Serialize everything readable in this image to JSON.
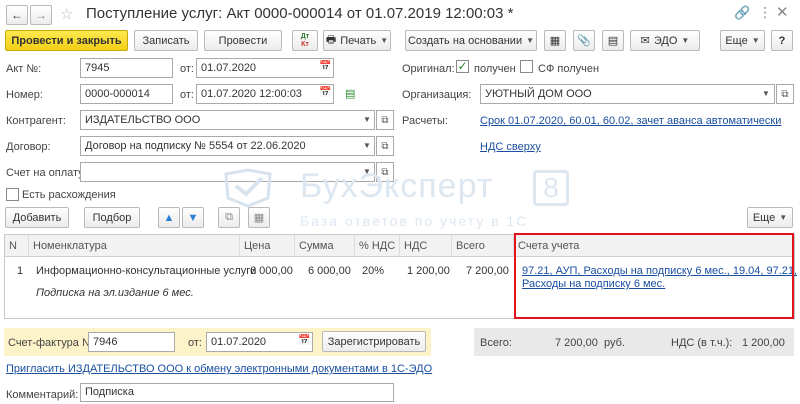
{
  "window": {
    "title": "Поступление услуг: Акт 0000-000014 от 01.07.2019 12:00:03 *"
  },
  "toolbar": {
    "post_close": "Провести и закрыть",
    "save": "Записать",
    "post": "Провести",
    "dt_kt": "Дт Кт",
    "print": "Печать",
    "create_based": "Создать на основании",
    "edo": "ЭДО",
    "more": "Еще",
    "help": "?"
  },
  "form": {
    "act_no_label": "Акт №:",
    "act_no": "7945",
    "from_label": "от:",
    "act_date": "01.07.2020",
    "number_label": "Номер:",
    "number": "0000-000014",
    "number_date": "01.07.2020 12:00:03",
    "original_label": "Оригинал:",
    "original_received": "получен",
    "sf_received": "СФ получен",
    "org_label": "Организация:",
    "org": "УЮТНЫЙ ДОМ ООО",
    "counterparty_label": "Контрагент:",
    "counterparty": "ИЗДАТЕЛЬСТВО ООО",
    "settlements_label": "Расчеты:",
    "settlements_link": "Срок 01.07.2020, 60.01, 60.02, зачет аванса автоматически",
    "contract_label": "Договор:",
    "contract": "Договор на подписку № 5554 от 22.06.2020",
    "vat_link": "НДС сверху",
    "invoice_label": "Счет на оплату:",
    "invoice": "",
    "discrepancy": "Есть расхождения"
  },
  "watermark": {
    "brand": "БухЭксперт",
    "num": "8",
    "tagline": "База ответов по учету в 1С"
  },
  "table_toolbar": {
    "add": "Добавить",
    "select": "Подбор",
    "more": "Еще"
  },
  "table": {
    "headers": [
      "N",
      "Номенклатура",
      "Цена",
      "Сумма",
      "% НДС",
      "НДС",
      "Всего",
      "Счета учета"
    ],
    "row": {
      "n": "1",
      "name": "Информационно-консультационные услуги",
      "content": "Подписка на эл.издание 6 мес.",
      "price": "6 000,00",
      "sum": "6 000,00",
      "vat_rate": "20%",
      "vat": "1 200,00",
      "total": "7 200,00",
      "accounts_line1": "97.21, АУП, Расходы на подписку 6 мес., 19.04, 97.21,",
      "accounts_line2": "Расходы на подписку 6 мес."
    }
  },
  "footer": {
    "sf_label": "Счет-фактура №:",
    "sf_number": "7946",
    "sf_from": "от:",
    "sf_date": "01.07.2020",
    "register": "Зарегистрировать",
    "total_label": "Всего:",
    "total_value": "7 200,00",
    "currency": "руб.",
    "vat_incl_label": "НДС (в т.ч.):",
    "vat_incl_value": "1 200,00",
    "invite_link": "Пригласить ИЗДАТЕЛЬСТВО ООО к обмену электронными документами в 1С-ЭДО",
    "comment_label": "Комментарий:",
    "comment": "Подписка"
  },
  "colors": {
    "highlight": "#e1141b",
    "link": "#1a4fa0",
    "primary": "#f5d21b"
  }
}
